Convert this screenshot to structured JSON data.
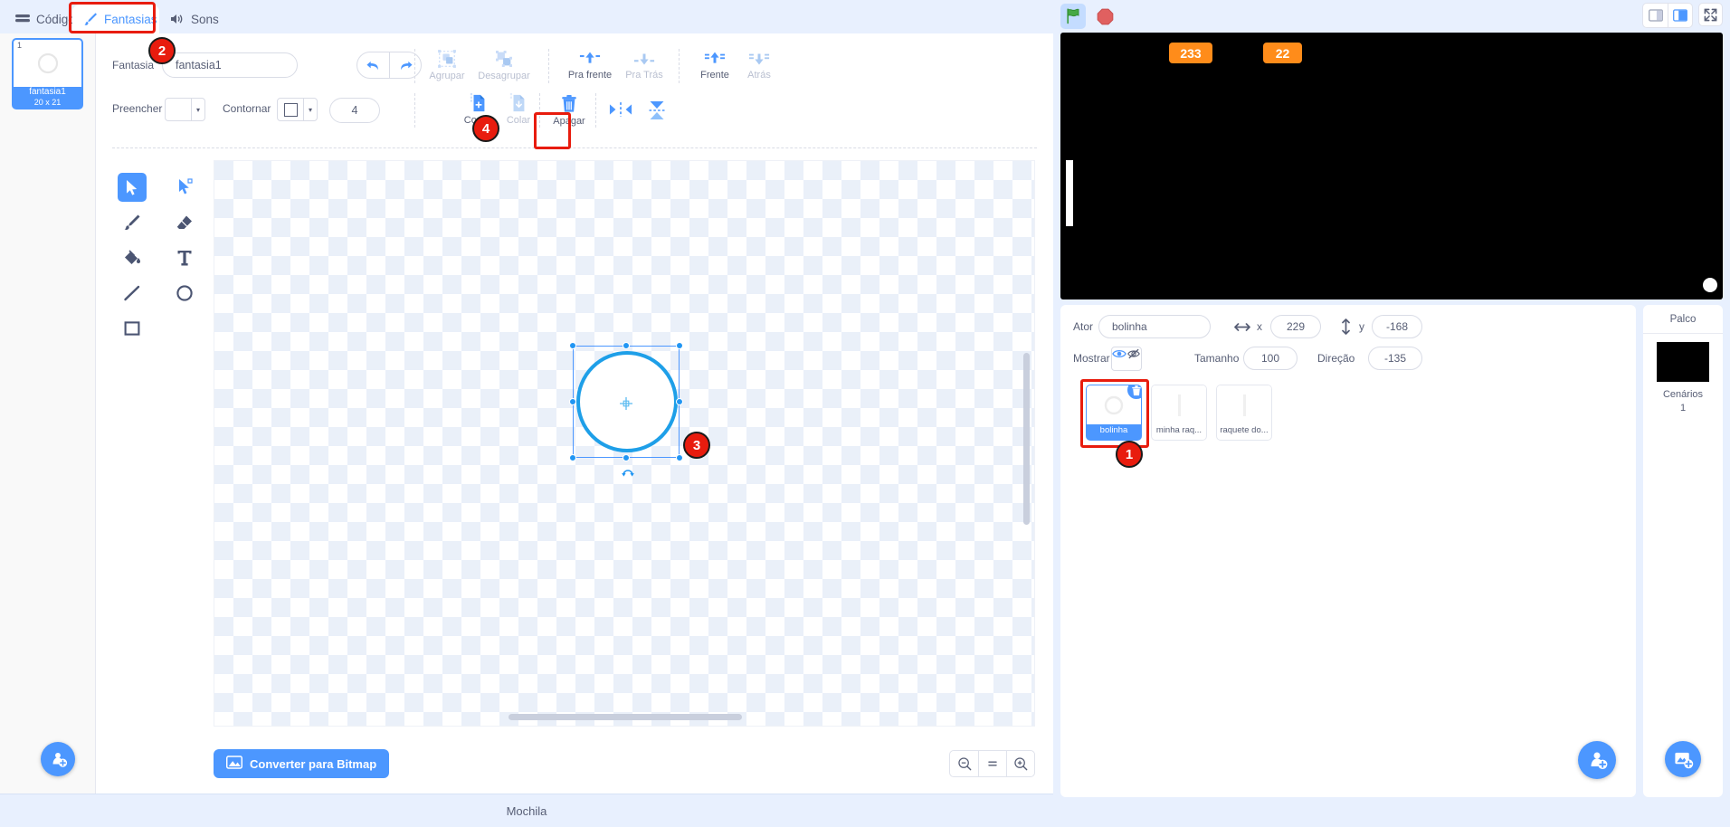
{
  "tabs": [
    {
      "label": "Código",
      "icon": "code-icon",
      "active": false
    },
    {
      "label": "Fantasias",
      "icon": "paintbrush-icon",
      "active": true
    },
    {
      "label": "Sons",
      "icon": "speaker-icon",
      "active": false
    }
  ],
  "costume_list": {
    "items": [
      {
        "number": "1",
        "name": "fantasia1",
        "size": "20 x 21",
        "selected": true
      }
    ],
    "add_button_icon": "add-costume-icon"
  },
  "paint_toolbar": {
    "costume_label": "Fantasia",
    "costume_name_value": "fantasia1",
    "undo_icon": "undo-icon",
    "redo_icon": "redo-icon",
    "group_label": "Agrupar",
    "ungroup_label": "Desagrupar",
    "forward_label": "Pra frente",
    "backward_label": "Pra Trás",
    "front_label": "Frente",
    "back_label": "Atrás",
    "fill_label": "Preencher",
    "outline_label": "Contornar",
    "stroke_width_value": "4",
    "copy_label": "Copiar",
    "paste_label": "Colar",
    "delete_label": "Apagar",
    "flip_horizontal_icon": "flip-horizontal-icon",
    "flip_vertical_icon": "flip-vertical-icon"
  },
  "tools": [
    {
      "name": "select-tool",
      "icon": "arrow-cursor-icon",
      "selected": true
    },
    {
      "name": "reshape-tool",
      "icon": "reshape-node-icon",
      "selected": false
    },
    {
      "name": "brush-tool",
      "icon": "paintbrush-icon",
      "selected": false
    },
    {
      "name": "eraser-tool",
      "icon": "eraser-icon",
      "selected": false
    },
    {
      "name": "fill-tool",
      "icon": "paint-bucket-icon",
      "selected": false
    },
    {
      "name": "text-tool",
      "icon": "text-t-icon",
      "selected": false
    },
    {
      "name": "line-tool",
      "icon": "line-icon",
      "selected": false
    },
    {
      "name": "circle-tool",
      "icon": "circle-icon",
      "selected": false
    },
    {
      "name": "rectangle-tool",
      "icon": "rectangle-icon",
      "selected": false
    }
  ],
  "canvas_footer": {
    "convert_label": "Converter para Bitmap",
    "convert_icon": "image-icon",
    "zoom_out_icon": "zoom-out-icon",
    "zoom_reset_icon": "zoom-reset-icon",
    "zoom_in_icon": "zoom-in-icon"
  },
  "stage_controls": {
    "green_flag_icon": "green-flag-icon",
    "stop_icon": "stop-sign-icon",
    "small_stage_icon": "small-stage-icon",
    "normal_stage_icon": "normal-stage-icon",
    "fullscreen_icon": "fullscreen-icon"
  },
  "stage": {
    "background_color": "#000000",
    "monitors": [
      {
        "name": "score-monitor-1",
        "value": "233",
        "color": "#ff8c1a"
      },
      {
        "name": "score-monitor-2",
        "value": "22",
        "color": "#ff8c1a"
      }
    ]
  },
  "sprite_info": {
    "actor_label": "Ator",
    "actor_value": "bolinha",
    "x_label": "x",
    "x_value": "229",
    "y_label": "y",
    "y_value": "-168",
    "show_label": "Mostrar",
    "visible_icon": "eye-icon",
    "hidden_icon": "eye-crossed-icon",
    "size_label": "Tamanho",
    "size_value": "100",
    "direction_label": "Direção",
    "direction_value": "-135"
  },
  "sprites": [
    {
      "name": "bolinha",
      "selected": true,
      "delete_icon": "trash-icon"
    },
    {
      "name": "minha raq...",
      "selected": false
    },
    {
      "name": "raquete do...",
      "selected": false
    }
  ],
  "sprite_pane": {
    "add_sprite_icon": "add-sprite-icon"
  },
  "stage_selector": {
    "title": "Palco",
    "backdrops_label": "Cenários",
    "backdrops_count": "1",
    "add_backdrop_icon": "add-backdrop-icon"
  },
  "backpack": {
    "label": "Mochila"
  },
  "step_badges": [
    {
      "id": "badge-1",
      "label": "1"
    },
    {
      "id": "badge-2",
      "label": "2"
    },
    {
      "id": "badge-3",
      "label": "3"
    },
    {
      "id": "badge-4",
      "label": "4"
    }
  ],
  "colors": {
    "accent": "#4c97ff",
    "highlight": "#e81c0e",
    "text": "#575e75",
    "monitor_orange": "#ff8c1a"
  }
}
